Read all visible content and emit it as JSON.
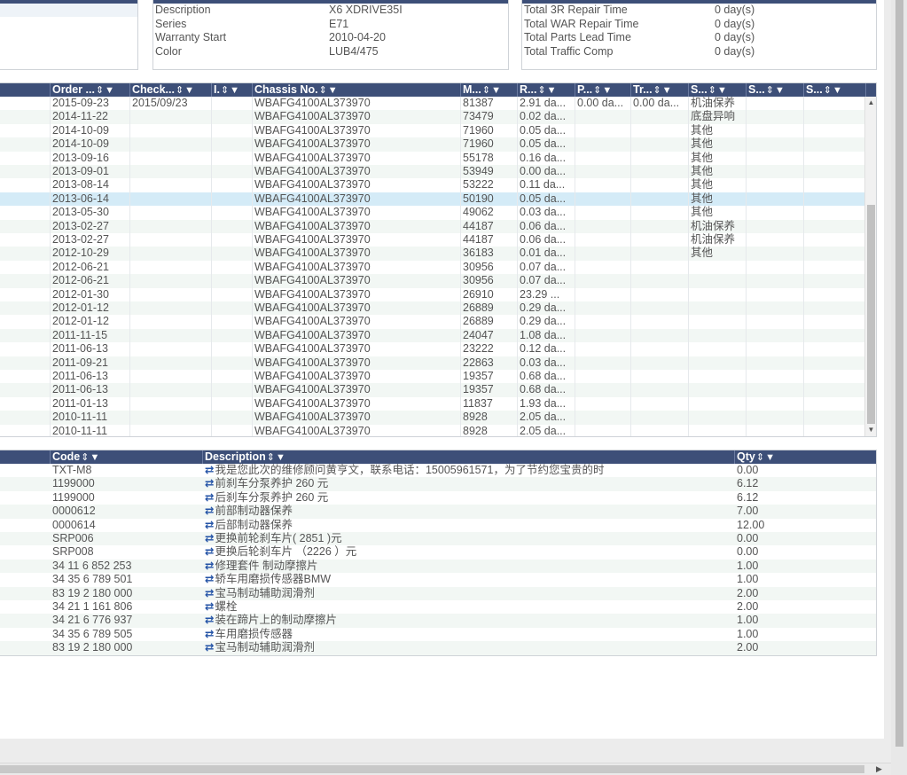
{
  "vehicle_info": [
    {
      "key": "Description",
      "value": "X6 XDRIVE35I"
    },
    {
      "key": "Series",
      "value": "E71"
    },
    {
      "key": "Warranty Start",
      "value": "2010-04-20"
    },
    {
      "key": "Color",
      "value": "LUB4/475"
    }
  ],
  "repair_stats": [
    {
      "key": "Total 3R Repair Time",
      "value": "0 day(s)"
    },
    {
      "key": "Total WAR Repair Time",
      "value": "0 day(s)"
    },
    {
      "key": "Total Parts Lead Time",
      "value": "0 day(s)"
    },
    {
      "key": "Total Traffic Comp",
      "value": "0 day(s)"
    }
  ],
  "orders": {
    "columns": [
      "Order ...",
      "Check...",
      "I.",
      "Chassis No.",
      "M...",
      "R...",
      "P...",
      "Tr...",
      "S...",
      "S...",
      "S..."
    ],
    "rows": [
      [
        "2015-09-23",
        "2015/09/23",
        "",
        "WBAFG4100AL373970",
        "81387",
        "2.91 da...",
        "0.00 da...",
        "0.00 da...",
        "机油保养",
        "",
        ""
      ],
      [
        "2014-11-22",
        "",
        "",
        "WBAFG4100AL373970",
        "73479",
        "0.02 da...",
        "",
        "",
        "底盘异响",
        "",
        ""
      ],
      [
        "2014-10-09",
        "",
        "",
        "WBAFG4100AL373970",
        "71960",
        "0.05 da...",
        "",
        "",
        "其他",
        "",
        ""
      ],
      [
        "2014-10-09",
        "",
        "",
        "WBAFG4100AL373970",
        "71960",
        "0.05 da...",
        "",
        "",
        "其他",
        "",
        ""
      ],
      [
        "2013-09-16",
        "",
        "",
        "WBAFG4100AL373970",
        "55178",
        "0.16 da...",
        "",
        "",
        "其他",
        "",
        ""
      ],
      [
        "2013-09-01",
        "",
        "",
        "WBAFG4100AL373970",
        "53949",
        "0.00 da...",
        "",
        "",
        "其他",
        "",
        ""
      ],
      [
        "2013-08-14",
        "",
        "",
        "WBAFG4100AL373970",
        "53222",
        "0.11 da...",
        "",
        "",
        "其他",
        "",
        ""
      ],
      [
        "2013-06-14",
        "",
        "",
        "WBAFG4100AL373970",
        "50190",
        "0.05 da...",
        "",
        "",
        "其他",
        "",
        ""
      ],
      [
        "2013-05-30",
        "",
        "",
        "WBAFG4100AL373970",
        "49062",
        "0.03 da...",
        "",
        "",
        "其他",
        "",
        ""
      ],
      [
        "2013-02-27",
        "",
        "",
        "WBAFG4100AL373970",
        "44187",
        "0.06 da...",
        "",
        "",
        "机油保养",
        "",
        ""
      ],
      [
        "2013-02-27",
        "",
        "",
        "WBAFG4100AL373970",
        "44187",
        "0.06 da...",
        "",
        "",
        "机油保养",
        "",
        ""
      ],
      [
        "2012-10-29",
        "",
        "",
        "WBAFG4100AL373970",
        "36183",
        "0.01 da...",
        "",
        "",
        "其他",
        "",
        ""
      ],
      [
        "2012-06-21",
        "",
        "",
        "WBAFG4100AL373970",
        "30956",
        "0.07 da...",
        "",
        "",
        "",
        "",
        ""
      ],
      [
        "2012-06-21",
        "",
        "",
        "WBAFG4100AL373970",
        "30956",
        "0.07 da...",
        "",
        "",
        "",
        "",
        ""
      ],
      [
        "2012-01-30",
        "",
        "",
        "WBAFG4100AL373970",
        "26910",
        "23.29 ...",
        "",
        "",
        "",
        "",
        ""
      ],
      [
        "2012-01-12",
        "",
        "",
        "WBAFG4100AL373970",
        "26889",
        "0.29 da...",
        "",
        "",
        "",
        "",
        ""
      ],
      [
        "2012-01-12",
        "",
        "",
        "WBAFG4100AL373970",
        "26889",
        "0.29 da...",
        "",
        "",
        "",
        "",
        ""
      ],
      [
        "2011-11-15",
        "",
        "",
        "WBAFG4100AL373970",
        "24047",
        "1.08 da...",
        "",
        "",
        "",
        "",
        ""
      ],
      [
        "2011-06-13",
        "",
        "",
        "WBAFG4100AL373970",
        "23222",
        "0.12 da...",
        "",
        "",
        "",
        "",
        ""
      ],
      [
        "2011-09-21",
        "",
        "",
        "WBAFG4100AL373970",
        "22863",
        "0.03 da...",
        "",
        "",
        "",
        "",
        ""
      ],
      [
        "2011-06-13",
        "",
        "",
        "WBAFG4100AL373970",
        "19357",
        "0.68 da...",
        "",
        "",
        "",
        "",
        ""
      ],
      [
        "2011-06-13",
        "",
        "",
        "WBAFG4100AL373970",
        "19357",
        "0.68 da...",
        "",
        "",
        "",
        "",
        ""
      ],
      [
        "2011-01-13",
        "",
        "",
        "WBAFG4100AL373970",
        "11837",
        "1.93 da...",
        "",
        "",
        "",
        "",
        ""
      ],
      [
        "2010-11-11",
        "",
        "",
        "WBAFG4100AL373970",
        "8928",
        "2.05 da...",
        "",
        "",
        "",
        "",
        ""
      ],
      [
        "2010-11-11",
        "",
        "",
        "WBAFG4100AL373970",
        "8928",
        "2.05 da...",
        "",
        "",
        "",
        "",
        ""
      ]
    ],
    "selected_row": 7
  },
  "parts": {
    "columns": [
      "Code",
      "Description",
      "Qty"
    ],
    "rows": [
      [
        "TXT-M8",
        "我是您此次的维修顾问黄亨文，联系电话：15005961571，为了节约您宝贵的时",
        "0.00"
      ],
      [
        "1199000",
        "前刹车分泵养护 260 元",
        "6.12"
      ],
      [
        "1199000",
        "后刹车分泵养护 260 元",
        "6.12"
      ],
      [
        "0000612",
        "前部制动器保养",
        "7.00"
      ],
      [
        "0000614",
        "后部制动器保养",
        "12.00"
      ],
      [
        "SRP006",
        "更换前轮刹车片( 2851 )元",
        "0.00"
      ],
      [
        "SRP008",
        "更换后轮刹车片 （2226 ）元",
        "0.00"
      ],
      [
        "34 11 6 852 253",
        "修理套件 制动摩擦片",
        "1.00"
      ],
      [
        "34 35 6 789 501",
        "轿车用磨损传感器BMW",
        "1.00"
      ],
      [
        "83 19 2 180 000",
        "宝马制动辅助润滑剂",
        "2.00"
      ],
      [
        "34 21 1 161 806",
        "螺栓",
        "2.00"
      ],
      [
        "34 21 6 776 937",
        "装在蹄片上的制动摩擦片",
        "1.00"
      ],
      [
        "34 35 6 789 505",
        "车用磨损传感器",
        "1.00"
      ],
      [
        "83 19 2 180 000",
        "宝马制动辅助润滑剂",
        "2.00"
      ]
    ]
  },
  "icons": {
    "sort": "⇕",
    "filter": "▼",
    "swap": "⇄"
  }
}
